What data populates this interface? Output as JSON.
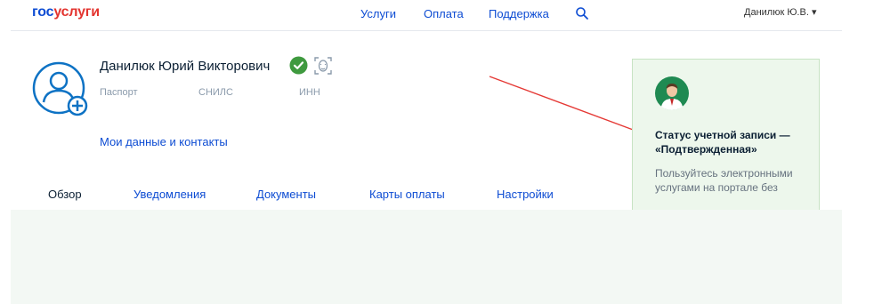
{
  "logo": {
    "part1": "гос",
    "part2": "услуги"
  },
  "nav": {
    "services": "Услуги",
    "payment": "Оплата",
    "support": "Поддержка"
  },
  "user_menu": "Данилюк Ю.В. ▾",
  "profile": {
    "name": "Данилюк Юрий Викторович",
    "passport_label": "Паспорт",
    "snils_label": "СНИЛС",
    "inn_label": "ИНН",
    "my_data_link": "Мои данные и контакты"
  },
  "tabs": [
    "Обзор",
    "Уведомления",
    "Документы",
    "Карты оплаты",
    "Настройки"
  ],
  "status_panel": {
    "title": "Статус учетной записи — «Подтвержденная»",
    "text": "Пользуйтесь электронными услугами на портале без"
  },
  "colors": {
    "brand_blue": "#0d4cd3",
    "brand_red": "#e3342f",
    "verified_green": "#3f9a3f",
    "panel_bg": "#edf7ec",
    "arrow_red": "#e53935"
  }
}
